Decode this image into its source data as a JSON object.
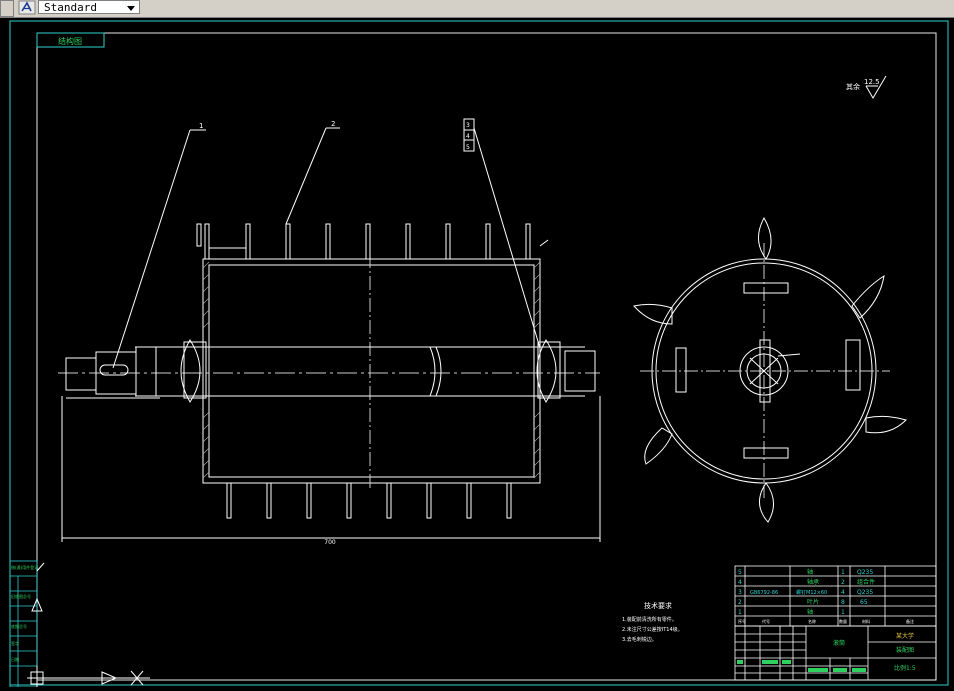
{
  "toolbar": {
    "style_select_value": "Standard",
    "style_icon": "text-style-icon"
  },
  "drawing": {
    "sheet_label": "结构图",
    "roughness_prefix": "其余",
    "roughness_value": "12.5",
    "balloons": [
      "1",
      "2",
      "3",
      "4",
      "5"
    ],
    "overall_length": "700",
    "tech_title": "技术要求",
    "tech_notes": [
      "1.装配前清洗所有零件。",
      "2.未注尺寸公差按IT14级。",
      "3.去毛刺锐边。"
    ],
    "bom_rows": [
      {
        "no": "5",
        "code": "",
        "name": "轴",
        "qty": "1",
        "mat": "Q235"
      },
      {
        "no": "4",
        "code": "",
        "name": "轴承",
        "qty": "2",
        "mat": "组合件"
      },
      {
        "no": "3",
        "code": "GB6792-86",
        "name": "螺钉M12×60",
        "qty": "4",
        "mat": "Q235"
      },
      {
        "no": "2",
        "code": "",
        "name": "叶片",
        "qty": "8",
        "mat": "65"
      },
      {
        "no": "1",
        "code": "",
        "name": "轴",
        "qty": "1",
        "mat": ""
      }
    ],
    "bom_header": {
      "no": "序号",
      "code": "代号",
      "name": "名称",
      "qty": "数量",
      "mat": "材料",
      "note": "备注"
    },
    "title_block": {
      "drawing_name": "滚筒",
      "school": "某大学",
      "sheet_no": "装配图",
      "drawing_no": "比例1:5"
    },
    "side_stamps": [
      "借(通)用件登记",
      "旧底图总号",
      "底图总号",
      "签字",
      "日期"
    ]
  }
}
